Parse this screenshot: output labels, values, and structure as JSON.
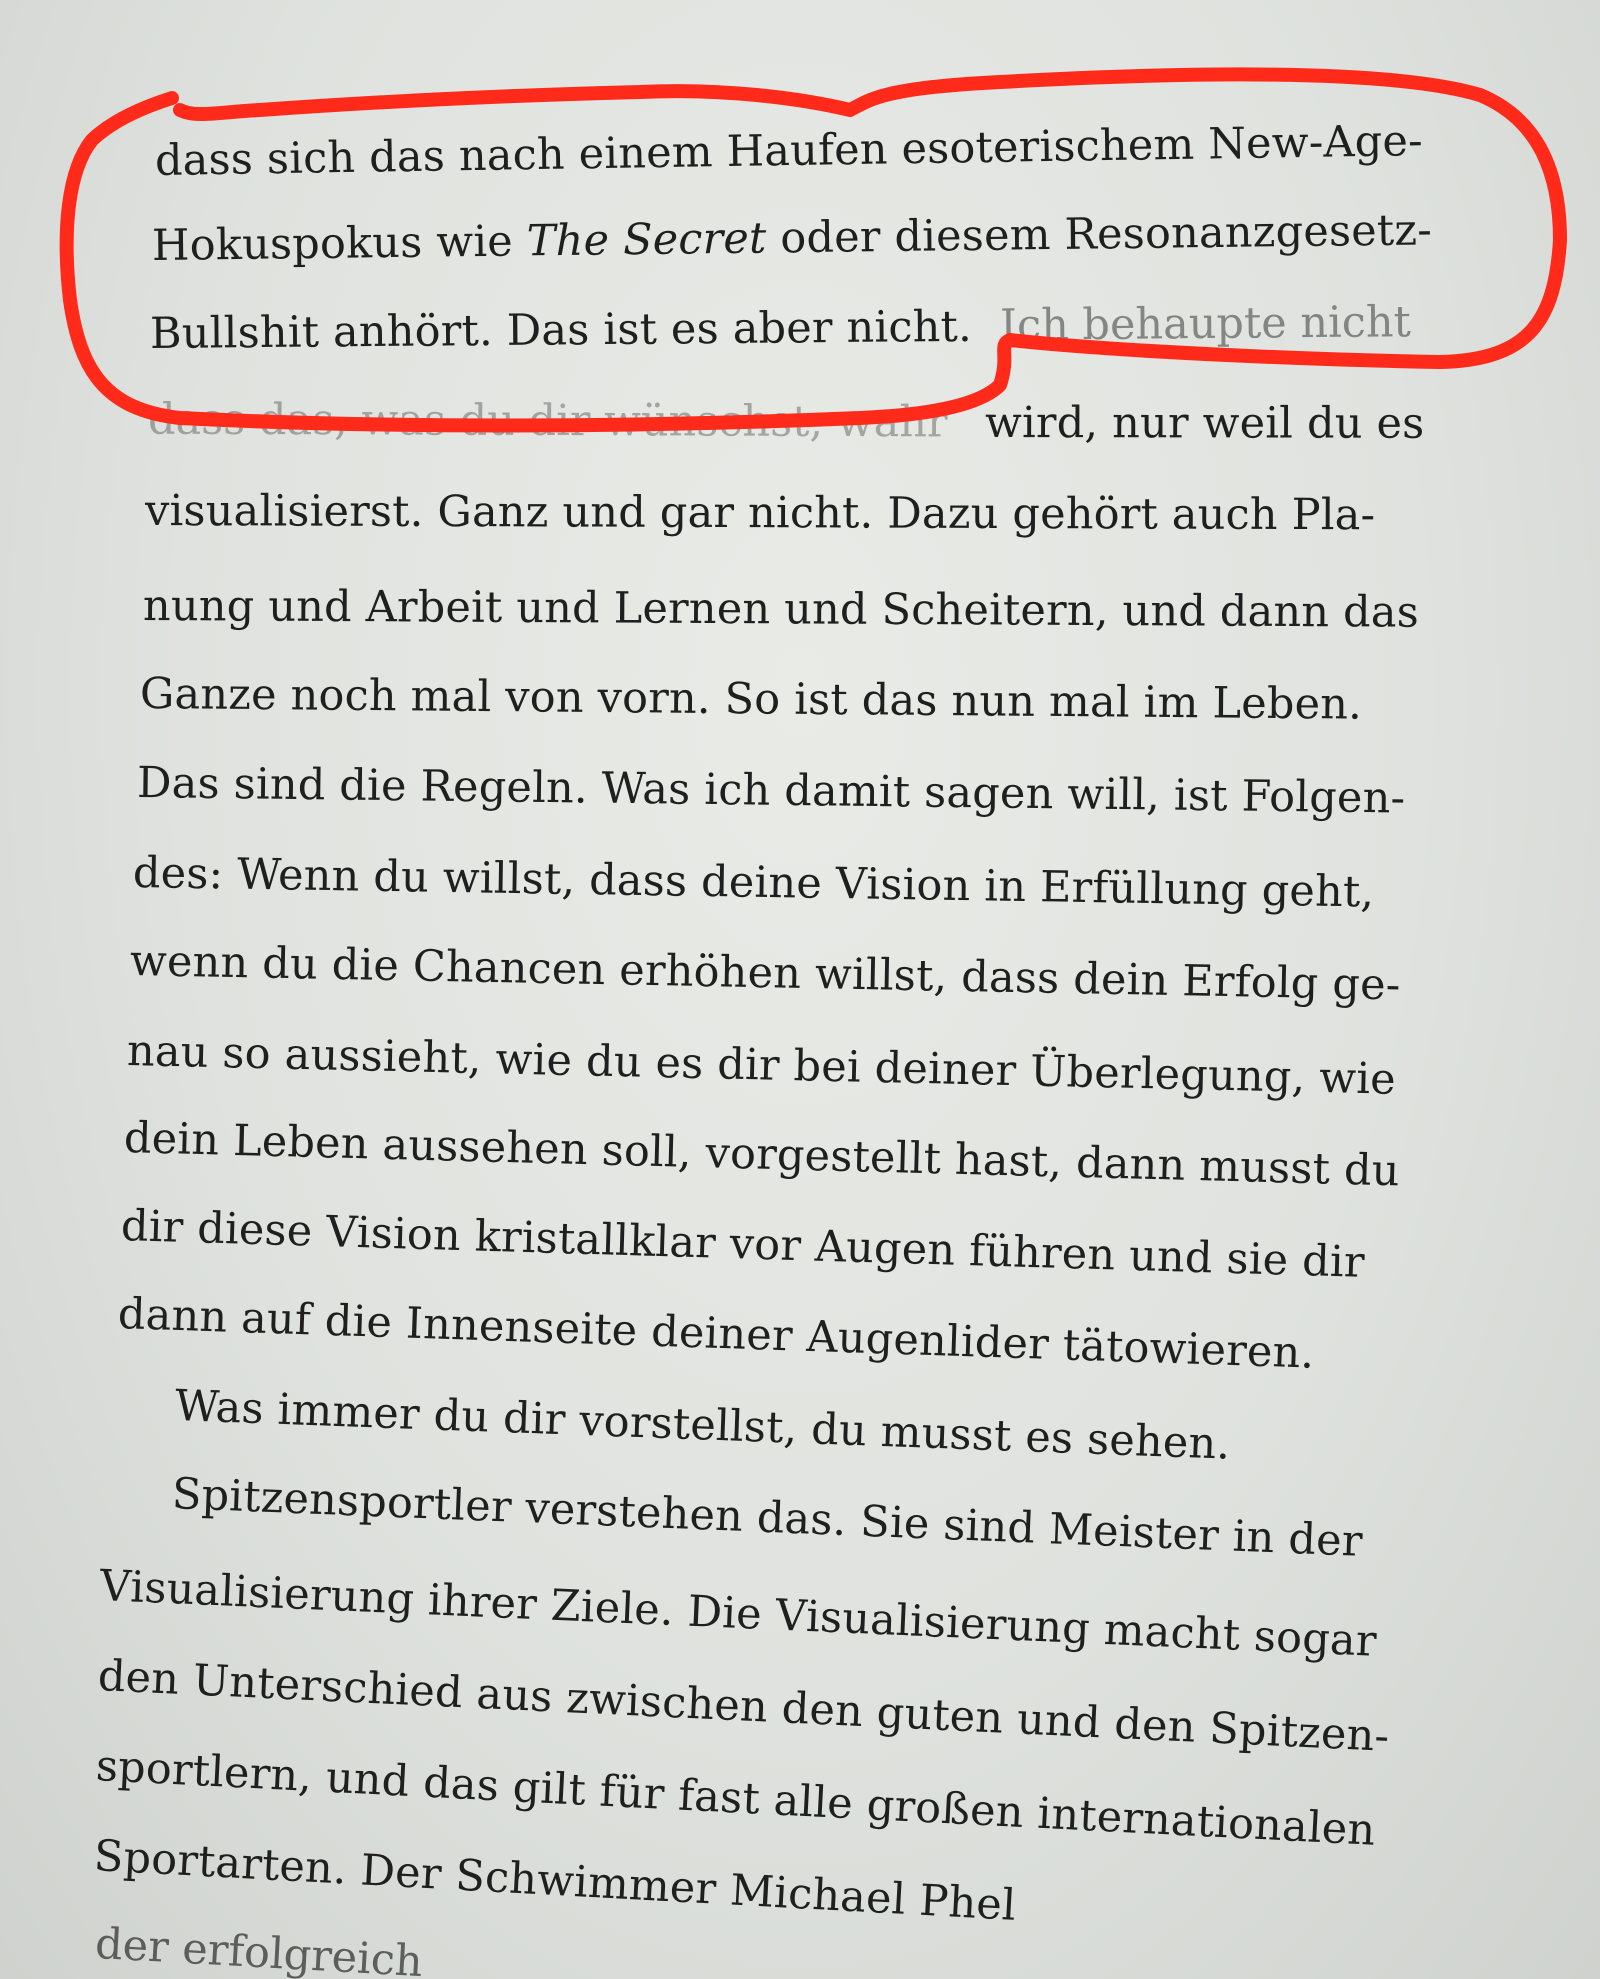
{
  "book_page": {
    "lines": [
      {
        "text": "dass sich das nach einem Haufen esoterischem New-Age-"
      },
      {
        "before": "Hokuspokus wie ",
        "italic": "The Secret",
        "after": " oder diesem Resonanzgesetz-"
      },
      {
        "text": "Bullshit anhört. Das ist es aber nicht."
      },
      {
        "text": "wird, nur weil du es"
      },
      {
        "text": "visualisierst. Ganz und gar nicht. Dazu gehört auch Pla-"
      },
      {
        "text": "nung und Arbeit und Lernen und Scheitern, und dann das"
      },
      {
        "text": "Ganze noch mal von vorn. So ist das nun mal im Leben."
      },
      {
        "text": "Das sind die Regeln. Was ich damit sagen will, ist Folgen-"
      },
      {
        "text": "des: Wenn du willst, dass deine Vision in Erfüllung geht,"
      },
      {
        "text": "wenn du die Chancen erhöhen willst, dass dein Erfolg ge-"
      },
      {
        "text": "nau so aussieht, wie du es dir bei deiner Überlegung, wie"
      },
      {
        "text": "dein Leben aussehen soll, vorgestellt hast, dann musst du"
      },
      {
        "text": "dir diese Vision kristallklar vor Augen führen und sie dir"
      },
      {
        "text": "dann auf die Innenseite deiner Augenlider tätowieren."
      },
      {
        "text": "Was immer du dir vorstellst, du musst es sehen."
      },
      {
        "text": "Spitzensportler verstehen das. Sie sind Meister in der"
      },
      {
        "text": "Visualisierung ihrer Ziele. Die Visualisierung macht sogar"
      },
      {
        "text": "den Unterschied aus zwischen den guten und den Spitzen-"
      },
      {
        "text": "sportlern, und das gilt für fast alle großen internationalen"
      },
      {
        "text": "Sportarten. Der Schwimmer Michael Phel"
      }
    ],
    "occluded": {
      "line3_tail": "Ich behaupte nicht",
      "line4_head": "dass das, was du dir wünschst, wahr",
      "line20": "der erfolgreich"
    },
    "colors": {
      "paper": "#e4e6e2",
      "ink": "#1f1f1f",
      "marker": "#ff2a1a"
    }
  }
}
